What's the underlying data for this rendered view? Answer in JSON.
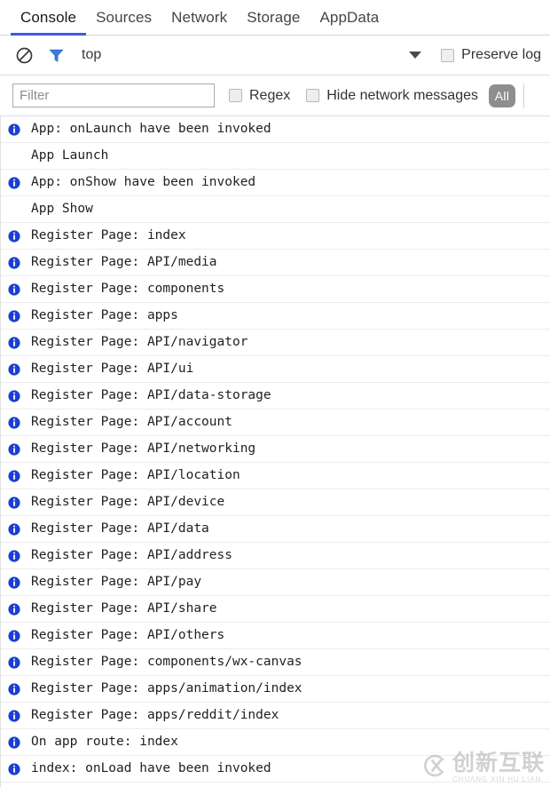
{
  "tabs": [
    {
      "label": "Console",
      "active": true
    },
    {
      "label": "Sources",
      "active": false
    },
    {
      "label": "Network",
      "active": false
    },
    {
      "label": "Storage",
      "active": false
    },
    {
      "label": "AppData",
      "active": false
    }
  ],
  "toolbar": {
    "clear_icon": "clear-console-icon",
    "filter_icon": "filter-funnel-icon",
    "context_label": "top",
    "context_caret": "chevron-down-icon",
    "preserve_log_label": "Preserve log",
    "preserve_log_checked": false
  },
  "filterbar": {
    "filter_value": "",
    "filter_placeholder": "Filter",
    "regex_label": "Regex",
    "regex_checked": false,
    "hide_network_label": "Hide network messages",
    "hide_network_checked": false,
    "level_button_label": "All"
  },
  "console": {
    "rows": [
      {
        "level": "info",
        "text": "App: onLaunch have been invoked"
      },
      {
        "level": "none",
        "text": "App Launch"
      },
      {
        "level": "info",
        "text": "App: onShow have been invoked"
      },
      {
        "level": "none",
        "text": "App Show"
      },
      {
        "level": "info",
        "text": "Register Page: index"
      },
      {
        "level": "info",
        "text": "Register Page: API/media"
      },
      {
        "level": "info",
        "text": "Register Page: components"
      },
      {
        "level": "info",
        "text": "Register Page: apps"
      },
      {
        "level": "info",
        "text": "Register Page: API/navigator"
      },
      {
        "level": "info",
        "text": "Register Page: API/ui"
      },
      {
        "level": "info",
        "text": "Register Page: API/data-storage"
      },
      {
        "level": "info",
        "text": "Register Page: API/account"
      },
      {
        "level": "info",
        "text": "Register Page: API/networking"
      },
      {
        "level": "info",
        "text": "Register Page: API/location"
      },
      {
        "level": "info",
        "text": "Register Page: API/device"
      },
      {
        "level": "info",
        "text": "Register Page: API/data"
      },
      {
        "level": "info",
        "text": "Register Page: API/address"
      },
      {
        "level": "info",
        "text": "Register Page: API/pay"
      },
      {
        "level": "info",
        "text": "Register Page: API/share"
      },
      {
        "level": "info",
        "text": "Register Page: API/others"
      },
      {
        "level": "info",
        "text": "Register Page: components/wx-canvas"
      },
      {
        "level": "info",
        "text": "Register Page: apps/animation/index"
      },
      {
        "level": "info",
        "text": "Register Page: apps/reddit/index"
      },
      {
        "level": "info",
        "text": "On app route: index"
      },
      {
        "level": "info",
        "text": "index: onLoad have been invoked"
      }
    ]
  },
  "watermark": {
    "cn": "创新互联",
    "en": "CHUANG XIN HU LIAN",
    "logo": "cx-circle-logo"
  },
  "colors": {
    "accent": "#3b5bdb",
    "info_icon": "#1a3fd4",
    "pill_bg": "#8e8e8e",
    "row_divider": "#ececec"
  }
}
